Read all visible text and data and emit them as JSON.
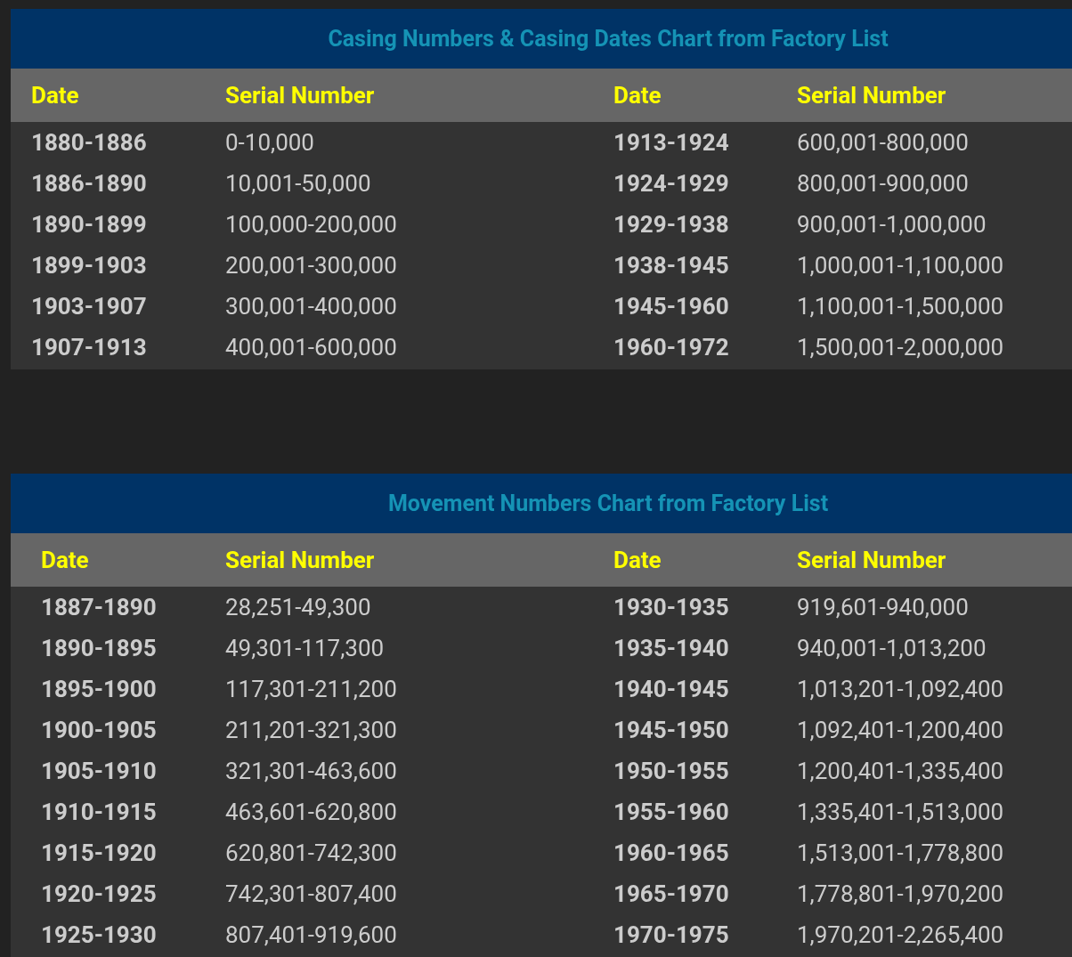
{
  "tables": [
    {
      "title": "Casing Numbers & Casing Dates Chart from Factory List",
      "columns": [
        "Date",
        "Serial Number",
        "Date",
        "Serial Number"
      ],
      "rows": [
        [
          "1880-1886",
          "0-10,000",
          "1913-1924",
          "600,001-800,000"
        ],
        [
          "1886-1890",
          "10,001-50,000",
          "1924-1929",
          "800,001-900,000"
        ],
        [
          "1890-1899",
          "100,000-200,000",
          "1929-1938",
          "900,001-1,000,000"
        ],
        [
          "1899-1903",
          "200,001-300,000",
          "1938-1945",
          "1,000,001-1,100,000"
        ],
        [
          "1903-1907",
          "300,001-400,000",
          "1945-1960",
          "1,100,001-1,500,000"
        ],
        [
          "1907-1913",
          "400,001-600,000",
          "1960-1972",
          "1,500,001-2,000,000"
        ]
      ]
    },
    {
      "title": "Movement Numbers Chart from Factory List",
      "columns": [
        "Date",
        "Serial Number",
        "Date",
        "Serial Number"
      ],
      "rows": [
        [
          "1887-1890",
          "28,251-49,300",
          "1930-1935",
          "919,601-940,000"
        ],
        [
          "1890-1895",
          "49,301-117,300",
          "1935-1940",
          "940,001-1,013,200"
        ],
        [
          "1895-1900",
          "117,301-211,200",
          "1940-1945",
          "1,013,201-1,092,400"
        ],
        [
          "1900-1905",
          "211,201-321,300",
          "1945-1950",
          "1,092,401-1,200,400"
        ],
        [
          "1905-1910",
          "321,301-463,600",
          "1950-1955",
          "1,200,401-1,335,400"
        ],
        [
          "1910-1915",
          "463,601-620,800",
          "1955-1960",
          "1,335,401-1,513,000"
        ],
        [
          "1915-1920",
          "620,801-742,300",
          "1960-1965",
          "1,513,001-1,778,800"
        ],
        [
          "1920-1925",
          "742,301-807,400",
          "1965-1970",
          "1,778,801-1,970,200"
        ],
        [
          "1925-1930",
          "807,401-919,600",
          "1970-1975",
          "1,970,201-2,265,400"
        ]
      ]
    }
  ]
}
